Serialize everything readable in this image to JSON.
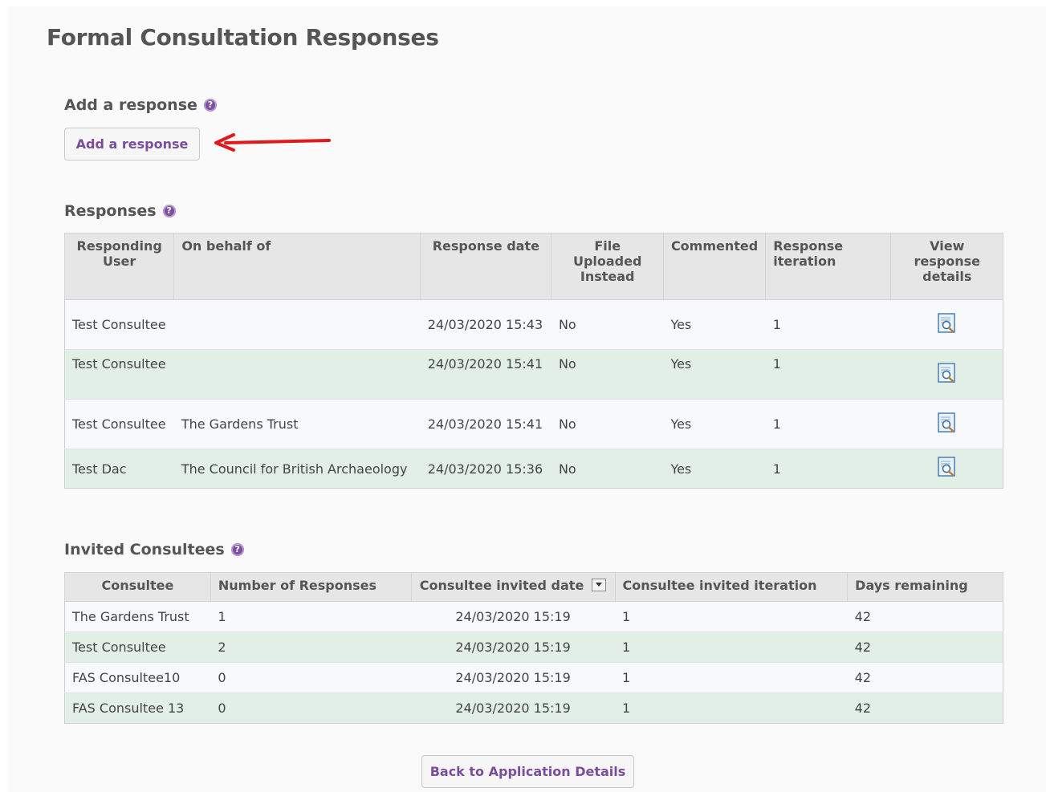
{
  "page": {
    "title": "Formal Consultation Responses"
  },
  "add_section": {
    "title": "Add a response",
    "button_label": "Add a response"
  },
  "responses": {
    "title": "Responses",
    "columns": [
      "Responding User",
      "On behalf of",
      "Response date",
      "File Uploaded Instead",
      "Commented",
      "Response iteration",
      "View response details"
    ],
    "rows": [
      {
        "user": "Test Consultee",
        "behalf": "",
        "date": "24/03/2020 15:43",
        "file": "No",
        "commented": "Yes",
        "iteration": "1"
      },
      {
        "user": "Test Consultee",
        "behalf": "",
        "date": "24/03/2020 15:41",
        "file": "No",
        "commented": "Yes",
        "iteration": "1"
      },
      {
        "user": "Test Consultee",
        "behalf": "The Gardens Trust",
        "date": "24/03/2020 15:41",
        "file": "No",
        "commented": "Yes",
        "iteration": "1"
      },
      {
        "user": "Test Dac",
        "behalf": "The Council for British Archaeology",
        "date": "24/03/2020 15:36",
        "file": "No",
        "commented": "Yes",
        "iteration": "1"
      }
    ]
  },
  "invited": {
    "title": "Invited Consultees",
    "columns": [
      "Consultee",
      "Number of Responses",
      "Consultee invited date",
      "Consultee invited iteration",
      "Days remaining"
    ],
    "rows": [
      {
        "consultee": "The Gardens Trust",
        "responses": "1",
        "date": "24/03/2020 15:19",
        "iteration": "1",
        "days": "42"
      },
      {
        "consultee": "Test Consultee",
        "responses": "2",
        "date": "24/03/2020 15:19",
        "iteration": "1",
        "days": "42"
      },
      {
        "consultee": "FAS Consultee10",
        "responses": "0",
        "date": "24/03/2020 15:19",
        "iteration": "1",
        "days": "42"
      },
      {
        "consultee": "FAS Consultee 13",
        "responses": "0",
        "date": "24/03/2020 15:19",
        "iteration": "1",
        "days": "42"
      }
    ]
  },
  "footer": {
    "back_button_label": "Back to Application Details"
  },
  "colors": {
    "accent": "#7a4e9c",
    "row_alt": "#e2efe6",
    "arrow": "#e0191b"
  },
  "icons": {
    "help": "help-icon",
    "view": "document-magnifier-icon",
    "sort": "sort-dropdown-icon",
    "pointer": "red-arrow-annotation"
  }
}
